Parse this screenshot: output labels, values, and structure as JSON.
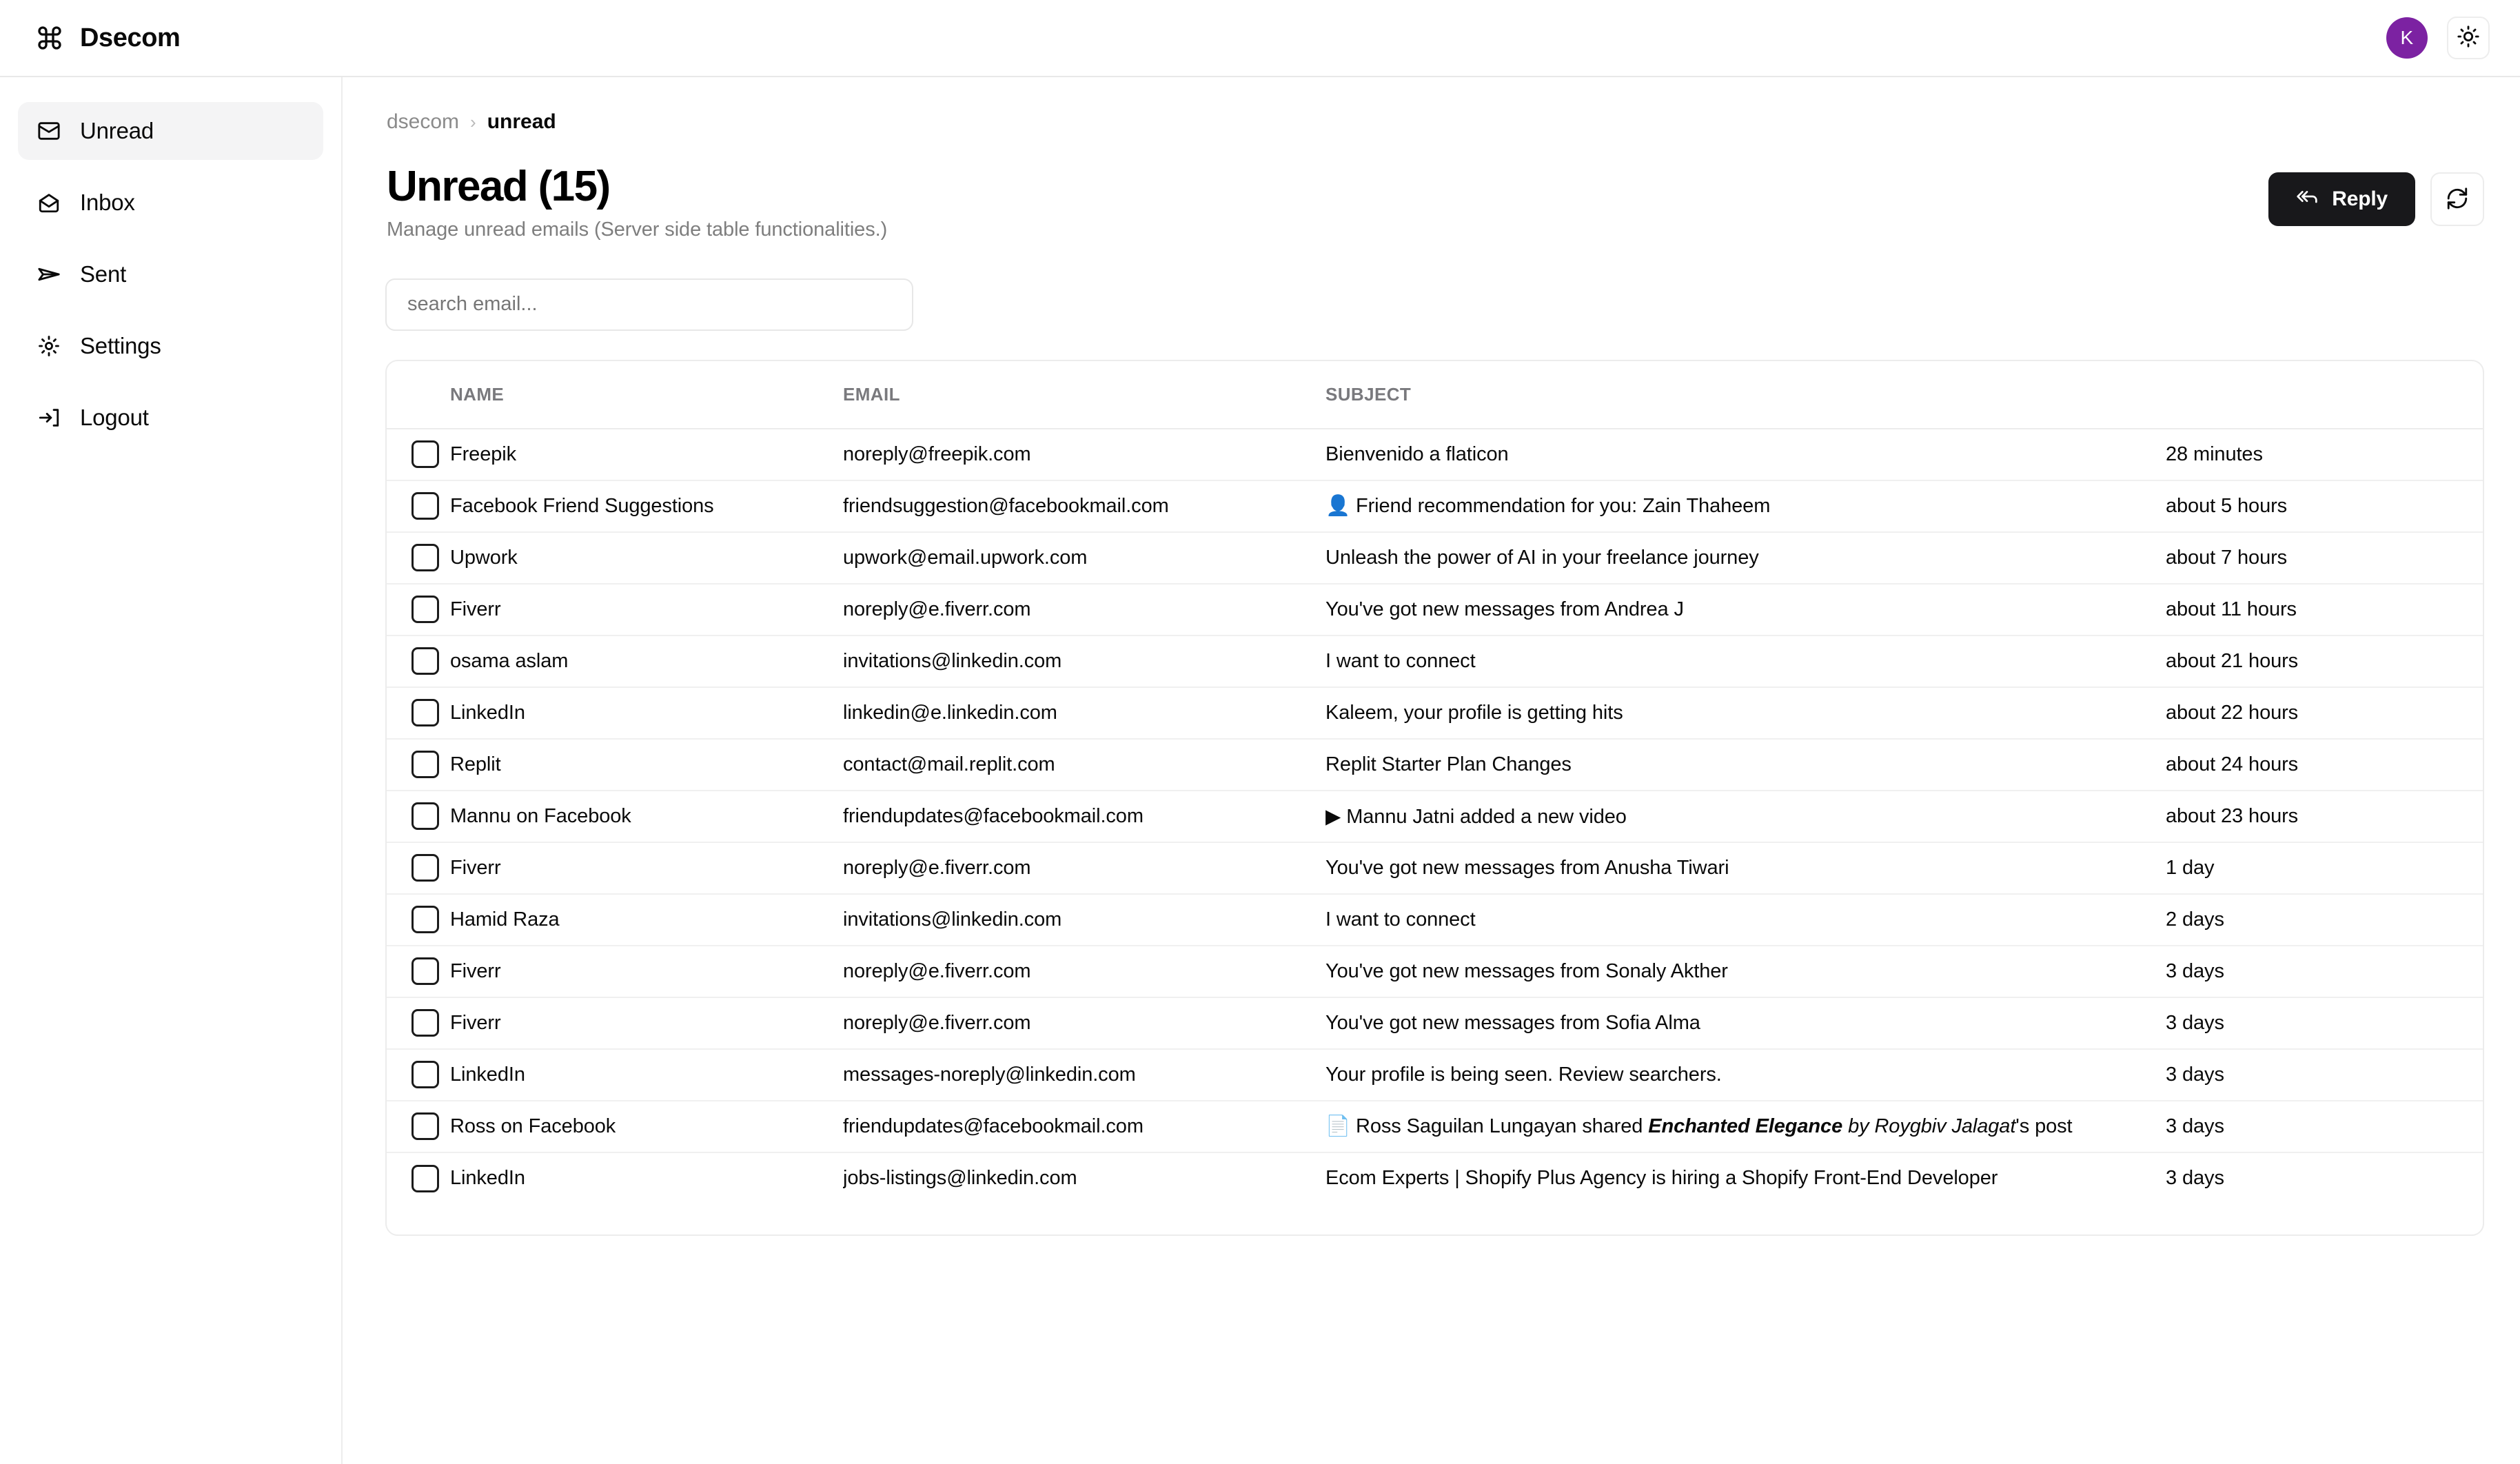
{
  "app": {
    "brand_name": "Dsecom",
    "brand_icon": "command-icon",
    "avatar_initial": "K",
    "avatar_color": "#7c22a2",
    "theme_toggle_icon": "sun-icon"
  },
  "sidebar": {
    "items": [
      {
        "label": "Unread",
        "icon": "envelope-closed-icon",
        "active": true
      },
      {
        "label": "Inbox",
        "icon": "envelope-open-icon",
        "active": false
      },
      {
        "label": "Sent",
        "icon": "paper-plane-icon",
        "active": false
      },
      {
        "label": "Settings",
        "icon": "gear-icon",
        "active": false
      },
      {
        "label": "Logout",
        "icon": "logout-arrow-icon",
        "active": false
      }
    ]
  },
  "breadcrumb": {
    "root": "dsecom",
    "separator": "›",
    "current": "unread"
  },
  "page": {
    "title": "Unread (15)",
    "subtitle": "Manage unread emails (Server side table functionalities.)"
  },
  "toolbar": {
    "reply_label": "Reply",
    "reply_icon": "reply-all-icon",
    "refresh_icon": "refresh-icon"
  },
  "search": {
    "placeholder": "search email...",
    "value": ""
  },
  "table": {
    "columns": [
      "NAME",
      "EMAIL",
      "SUBJECT",
      ""
    ],
    "rows": [
      {
        "name": "Freepik",
        "email": "noreply@freepik.com",
        "subject": "Bienvenido a flaticon",
        "emoji": "",
        "time": "28 minutes"
      },
      {
        "name": "Facebook Friend Suggestions",
        "email": "friendsuggestion@facebookmail.com",
        "subject": "Friend recommendation for you: Zain Thaheem",
        "emoji": "👤",
        "time": "about 5 hours"
      },
      {
        "name": "Upwork",
        "email": "upwork@email.upwork.com",
        "subject": "Unleash the power of AI in your freelance journey",
        "emoji": "",
        "time": "about 7 hours"
      },
      {
        "name": "Fiverr",
        "email": "noreply@e.fiverr.com",
        "subject": "You've got new messages from Andrea J",
        "emoji": "",
        "time": "about 11 hours"
      },
      {
        "name": "osama aslam",
        "email": "invitations@linkedin.com",
        "subject": "I want to connect",
        "emoji": "",
        "time": "about 21 hours"
      },
      {
        "name": "LinkedIn",
        "email": "linkedin@e.linkedin.com",
        "subject": "Kaleem, your profile is getting hits",
        "emoji": "",
        "time": "about 22 hours"
      },
      {
        "name": "Replit",
        "email": "contact@mail.replit.com",
        "subject": "Replit Starter Plan Changes",
        "emoji": "",
        "time": "about 24 hours"
      },
      {
        "name": "Mannu on Facebook",
        "email": "friendupdates@facebookmail.com",
        "subject": "Mannu Jatni added a new video",
        "emoji": "▶",
        "time": "about 23 hours"
      },
      {
        "name": "Fiverr",
        "email": "noreply@e.fiverr.com",
        "subject": "You've got new messages from Anusha Tiwari",
        "emoji": "",
        "time": "1 day"
      },
      {
        "name": "Hamid Raza",
        "email": "invitations@linkedin.com",
        "subject": "I want to connect",
        "emoji": "",
        "time": "2 days"
      },
      {
        "name": "Fiverr",
        "email": "noreply@e.fiverr.com",
        "subject": "You've got new messages from Sonaly Akther",
        "emoji": "",
        "time": "3 days"
      },
      {
        "name": "Fiverr",
        "email": "noreply@e.fiverr.com",
        "subject": "You've got new messages from Sofia Alma",
        "emoji": "",
        "time": "3 days"
      },
      {
        "name": "LinkedIn",
        "email": "messages-noreply@linkedin.com",
        "subject": "Your profile is being seen. Review searchers.",
        "emoji": "",
        "time": "3 days"
      },
      {
        "name": "Ross on Facebook",
        "email": "friendupdates@facebookmail.com",
        "subject": "Ross Saguilan Lungayan shared Enchanted Elegance by Roygbiv Jalagat's post",
        "emoji": "📄",
        "subject_parts": [
          {
            "text": "Ross Saguilan Lungayan shared ",
            "style": "normal"
          },
          {
            "text": "Enchanted Elegance",
            "style": "bold-italic"
          },
          {
            "text": " by Roygbiv Jalagat",
            "style": "italic"
          },
          {
            "text": "'s post",
            "style": "normal"
          }
        ],
        "time": "3 days"
      },
      {
        "name": "LinkedIn",
        "email": "jobs-listings@linkedin.com",
        "subject": "Ecom Experts | Shopify Plus Agency is hiring a Shopify Front-End Developer",
        "emoji": "",
        "time": "3 days"
      }
    ]
  }
}
